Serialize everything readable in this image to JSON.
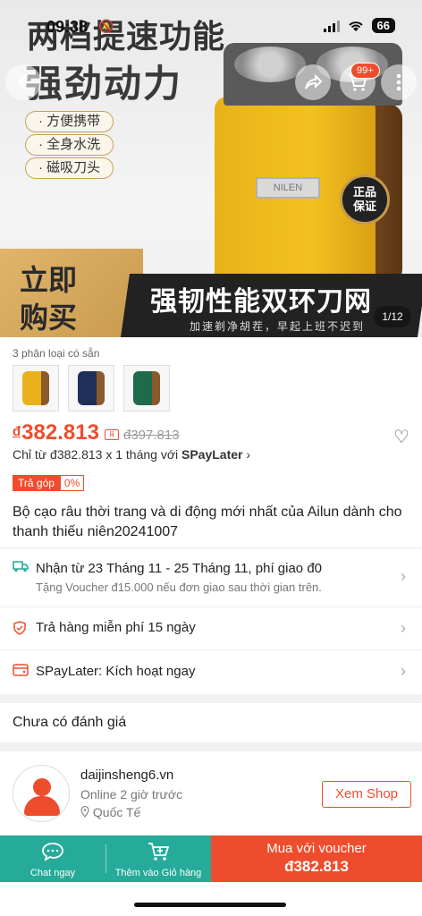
{
  "status_bar": {
    "time": "09:38",
    "battery": "66"
  },
  "hero": {
    "title_line1": "两档提速功能",
    "title_line2": "强劲动力",
    "features": [
      "方便携带",
      "全身水洗",
      "磁吸刀头"
    ],
    "brand_plate": "NILEN",
    "authentic_badge": [
      "正品",
      "保证"
    ],
    "banner_left": [
      "立即",
      "购买"
    ],
    "banner_main": "强韧性能双环刀网",
    "banner_sub": "加速剃净胡茬，早起上班不迟到",
    "image_counter": "1/12",
    "cart_badge": "99+"
  },
  "variants": {
    "label": "3 phân loại có sẵn",
    "colors": [
      "#e9b21c",
      "#1e2f5a",
      "#1f6a4a"
    ],
    "accent": "#8a5a2c"
  },
  "price": {
    "currency": "đ",
    "current": "382.813",
    "original": "đ397.813",
    "flag": "ⅲ"
  },
  "spaylater": {
    "text_prefix": "Chỉ từ đ382.813 x 1 tháng với ",
    "brand": "SPayLater",
    "chevron": "›"
  },
  "installment": {
    "label": "Trả góp",
    "rate": "0%"
  },
  "product_title": "Bộ cạo râu thời trang và di động mới nhất của Ailun dành cho thanh thiếu niên20241007",
  "rows": {
    "shipping": {
      "text": "Nhận từ 23 Tháng 11 - 25 Tháng 11, phí giao đ0",
      "sub": "Tặng Voucher đ15.000 nếu đơn giao sau thời gian trên.",
      "icon": "truck-icon"
    },
    "returns": {
      "text": "Trả hàng miễn phí 15 ngày",
      "icon": "shield-icon"
    },
    "spaylater": {
      "text": "SPayLater: Kích hoạt ngay",
      "icon": "wallet-icon"
    }
  },
  "rating": {
    "text": "Chưa có đánh giá"
  },
  "shop": {
    "name": "daijinsheng6.vn",
    "online": "Online 2 giờ trước",
    "location": "Quốc Tế",
    "button": "Xem Shop"
  },
  "bottom_bar": {
    "chat_label": "Chat ngay",
    "cart_label": "Thêm vào Giỏ hàng",
    "buy_line1": "Mua với voucher",
    "buy_line2": "đ382.813"
  },
  "colors": {
    "primary": "#ee4d2d",
    "teal": "#26aa99"
  }
}
